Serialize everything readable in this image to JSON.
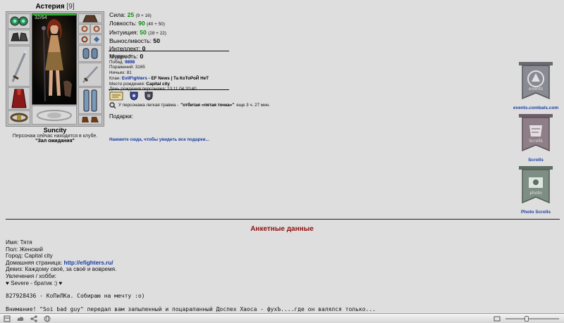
{
  "character": {
    "name": "Астерия",
    "level": "[9]",
    "hp": "32/64",
    "hp_fraction": 1.0,
    "location": "Suncity",
    "club_status": "Персонаж сейчас находится в клубе.",
    "room": "\"Зал ожидания\""
  },
  "stats": [
    {
      "label": "Сила:",
      "value": "25",
      "detail": "(9 + 16)"
    },
    {
      "label": "Ловкость:",
      "value": "90",
      "detail": "(40 + 50)"
    },
    {
      "label": "Интуиция:",
      "value": "50",
      "detail": "(28 + 22)"
    },
    {
      "label": "Выносливость:",
      "value": "50",
      "detail": ""
    },
    {
      "label": "Интеллект:",
      "value": "0",
      "detail": ""
    },
    {
      "label": "Мудрость:",
      "value": "0",
      "detail": ""
    }
  ],
  "info": {
    "level_label": "Уровень:",
    "level_value": "9",
    "wins_label": "Побед:",
    "wins_value": "9898",
    "losses_label": "Поражений:",
    "losses_value": "3165",
    "draws_label": "Ничьих:",
    "draws_value": "81",
    "clan_label": "Клан:",
    "clan_value": "EvilFighters",
    "clan_extra": "- EF News | Та КоТоРоЙ НеТ",
    "birthplace_label": "Место рождения:",
    "birthplace_value": "Capital city",
    "birthday_label": "День рождения персонажа:",
    "birthday_value": "13.11.04 20:40"
  },
  "trauma": {
    "prefix": "У персонажа легкая травма -",
    "name": "\"отбитая «пятая точка»\"",
    "suffix": "еще 3 ч. 27 мин."
  },
  "gifts": {
    "label": "Подарки:",
    "link": "Нажмите сюда, чтобы увидеть все подарки..."
  },
  "banners": [
    {
      "caption": "events.combats.com",
      "text": "events",
      "color": "#5e5e66"
    },
    {
      "caption": "Scrolls",
      "text": "Scrolls",
      "color": "#6e5e68"
    },
    {
      "caption": "Photo Scrolls",
      "text": "photo",
      "color": "#5e6e64"
    }
  ],
  "profile": {
    "title": "Анкетные данные",
    "name_line": "Имя: Тятя",
    "gender_line": "Пол: Женский",
    "city_line": "Город: Capital city",
    "homepage_label": "Домашняя страница:",
    "homepage_url": "http://efighters.ru/",
    "motto_line": "Девиз: Каждому своё, за своё и вовремя.",
    "hobby_line": "Увлечения / хобби:",
    "hobby_value": "♥ Severe - братик :) ♥",
    "icq_line": "827928436 - КоПиЛКа. Собираю на мечту :o)",
    "note_line": "Внимание! \"Soi bad guy\" передал вам запыленный и поцарапанный Доспех Хаоса - фухЪ....где он валялся только..."
  },
  "overflow_line": "  ...",
  "statusbar": {
    "zoom_fraction": 0.4
  }
}
